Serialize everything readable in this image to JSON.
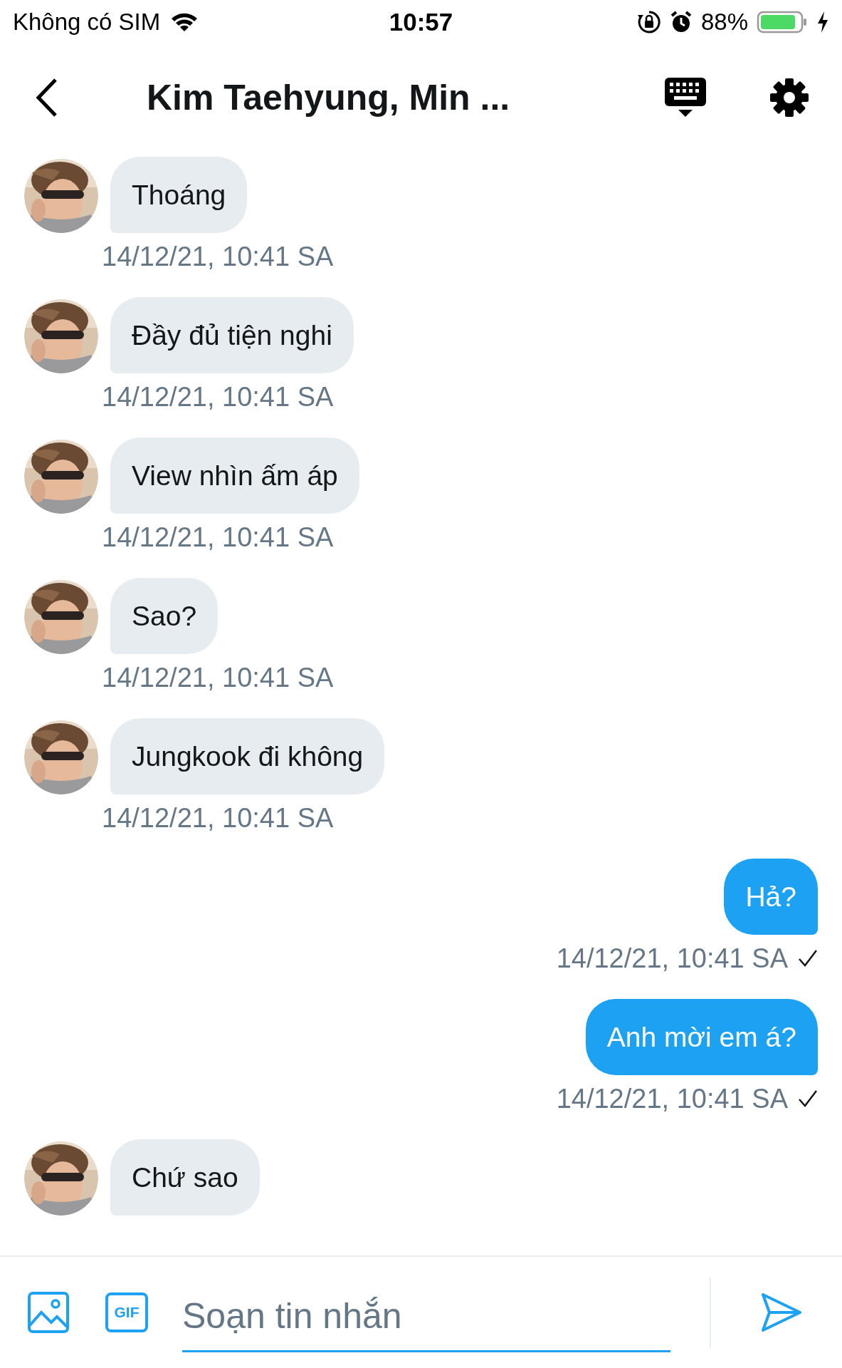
{
  "status_bar": {
    "carrier": "Không có SIM",
    "time": "10:57",
    "battery": "88%"
  },
  "header": {
    "title": "Kim Taehyung, Min ..."
  },
  "messages": [
    {
      "kind": "received",
      "text": "Thoáng",
      "time": "14/12/21, 10:41 SA"
    },
    {
      "kind": "received",
      "text": "Đầy đủ tiện nghi",
      "time": "14/12/21, 10:41 SA"
    },
    {
      "kind": "received",
      "text": "View nhìn ấm áp",
      "time": "14/12/21, 10:41 SA"
    },
    {
      "kind": "received",
      "text": "Sao?",
      "time": "14/12/21, 10:41 SA"
    },
    {
      "kind": "received",
      "text": "Jungkook đi không",
      "time": "14/12/21, 10:41 SA"
    },
    {
      "kind": "sent",
      "text": "Hả?",
      "time": "14/12/21, 10:41 SA",
      "delivered": true
    },
    {
      "kind": "sent",
      "text": "Anh mời em á?",
      "time": "14/12/21, 10:41 SA",
      "delivered": true
    },
    {
      "kind": "received",
      "text": "Chứ sao"
    }
  ],
  "composer": {
    "gif_label": "GIF",
    "placeholder": "Soạn tin nhắn"
  }
}
